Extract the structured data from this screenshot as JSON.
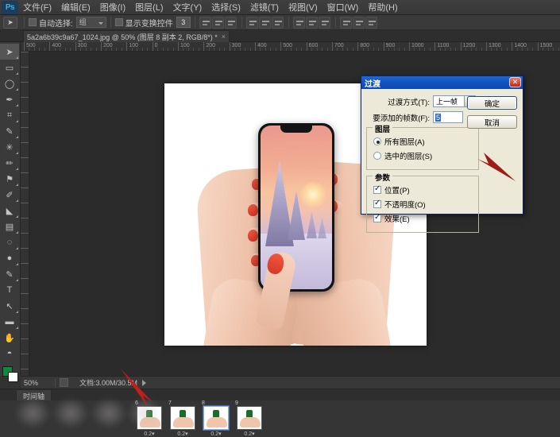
{
  "app": {
    "name": "Ps",
    "logo_text": "Ps"
  },
  "menubar": {
    "items": [
      {
        "label": "文件(F)"
      },
      {
        "label": "编辑(E)"
      },
      {
        "label": "图像(I)"
      },
      {
        "label": "图层(L)"
      },
      {
        "label": "文字(Y)"
      },
      {
        "label": "选择(S)"
      },
      {
        "label": "滤镜(T)"
      },
      {
        "label": "视图(V)"
      },
      {
        "label": "窗口(W)"
      },
      {
        "label": "帮助(H)"
      }
    ]
  },
  "options_bar": {
    "tool_icon": "move-tool-icon",
    "auto_select_label": "自动选择:",
    "auto_select_value": "组",
    "show_transform_label": "显示变换控件",
    "layer_count_value": "3"
  },
  "document_tab": {
    "title": "5a2a6b39c9a67_1024.jpg @ 50% (图层 8 副本 2, RGB/8*) *",
    "close_glyph": "×"
  },
  "toolbar": {
    "tools": [
      {
        "name": "move-tool",
        "glyph": "➤"
      },
      {
        "name": "marquee-tool",
        "glyph": "▭"
      },
      {
        "name": "lasso-tool",
        "glyph": "◯"
      },
      {
        "name": "quick-select-tool",
        "glyph": "✒"
      },
      {
        "name": "crop-tool",
        "glyph": "⌗"
      },
      {
        "name": "eyedropper-tool",
        "glyph": "✎"
      },
      {
        "name": "spot-heal-tool",
        "glyph": "✳"
      },
      {
        "name": "brush-tool",
        "glyph": "✏"
      },
      {
        "name": "clone-stamp-tool",
        "glyph": "⚑"
      },
      {
        "name": "history-brush-tool",
        "glyph": "✐"
      },
      {
        "name": "eraser-tool",
        "glyph": "◣"
      },
      {
        "name": "gradient-tool",
        "glyph": "▤"
      },
      {
        "name": "blur-tool",
        "glyph": "◌"
      },
      {
        "name": "dodge-tool",
        "glyph": "●"
      },
      {
        "name": "pen-tool",
        "glyph": "✎"
      },
      {
        "name": "type-tool",
        "glyph": "T"
      },
      {
        "name": "path-select-tool",
        "glyph": "↖"
      },
      {
        "name": "shape-tool",
        "glyph": "▬"
      },
      {
        "name": "hand-tool",
        "glyph": "✋"
      },
      {
        "name": "zoom-tool",
        "glyph": "🔍"
      }
    ],
    "foreground_color": "#0d8a3e",
    "background_color": "#ffffff"
  },
  "ruler": {
    "horizontal_ticks": [
      "500",
      "400",
      "300",
      "200",
      "100",
      "0",
      "100",
      "200",
      "300",
      "400",
      "500",
      "600",
      "700",
      "800",
      "900",
      "1000",
      "1100",
      "1200",
      "1300",
      "1400",
      "1500"
    ],
    "unit_hint": "px"
  },
  "dialog": {
    "title": "过渡",
    "close_glyph": "✕",
    "transition_label": "过渡方式(T):",
    "transition_value": "上一帧",
    "frames_label": "要添加的帧数(F):",
    "frames_value": "5",
    "layers_group": {
      "title": "图层",
      "options": [
        {
          "label": "所有图层(A)",
          "selected": true
        },
        {
          "label": "选中的图层(S)",
          "selected": false
        }
      ]
    },
    "params_group": {
      "title": "参数",
      "options": [
        {
          "label": "位置(P)",
          "checked": true
        },
        {
          "label": "不透明度(O)",
          "checked": true
        },
        {
          "label": "效果(E)",
          "checked": true
        }
      ]
    },
    "ok_label": "确定",
    "cancel_label": "取消",
    "accent_color": "#0b49b4"
  },
  "annotations": {
    "arrow_color": "#b01e1e",
    "arrows": [
      {
        "name": "dialog-pointer-arrow"
      },
      {
        "name": "timeline-pointer-arrow"
      }
    ]
  },
  "status_bar": {
    "zoom": "50%",
    "doc_label": "文档:3.00M/30.5M"
  },
  "timeline": {
    "tab_label": "时间轴",
    "frames": [
      {
        "number": "",
        "delay": "",
        "visible": false,
        "selected": false
      },
      {
        "number": "",
        "delay": "",
        "visible": false,
        "selected": false
      },
      {
        "number": "",
        "delay": "",
        "visible": false,
        "selected": false
      },
      {
        "number": "",
        "delay": "",
        "visible": false,
        "selected": false
      },
      {
        "number": "6",
        "delay": "0.2▾",
        "visible": true,
        "selected": false
      },
      {
        "number": "7",
        "delay": "0.2▾",
        "visible": true,
        "selected": false
      },
      {
        "number": "8",
        "delay": "0.2▾",
        "visible": true,
        "selected": true
      },
      {
        "number": "9",
        "delay": "0.2▾",
        "visible": true,
        "selected": false
      }
    ]
  },
  "canvas": {
    "artboard_background": "#ffffff",
    "subject": "hands-holding-phone-photo",
    "phone_screen": "winter-sunset-wallpaper"
  }
}
